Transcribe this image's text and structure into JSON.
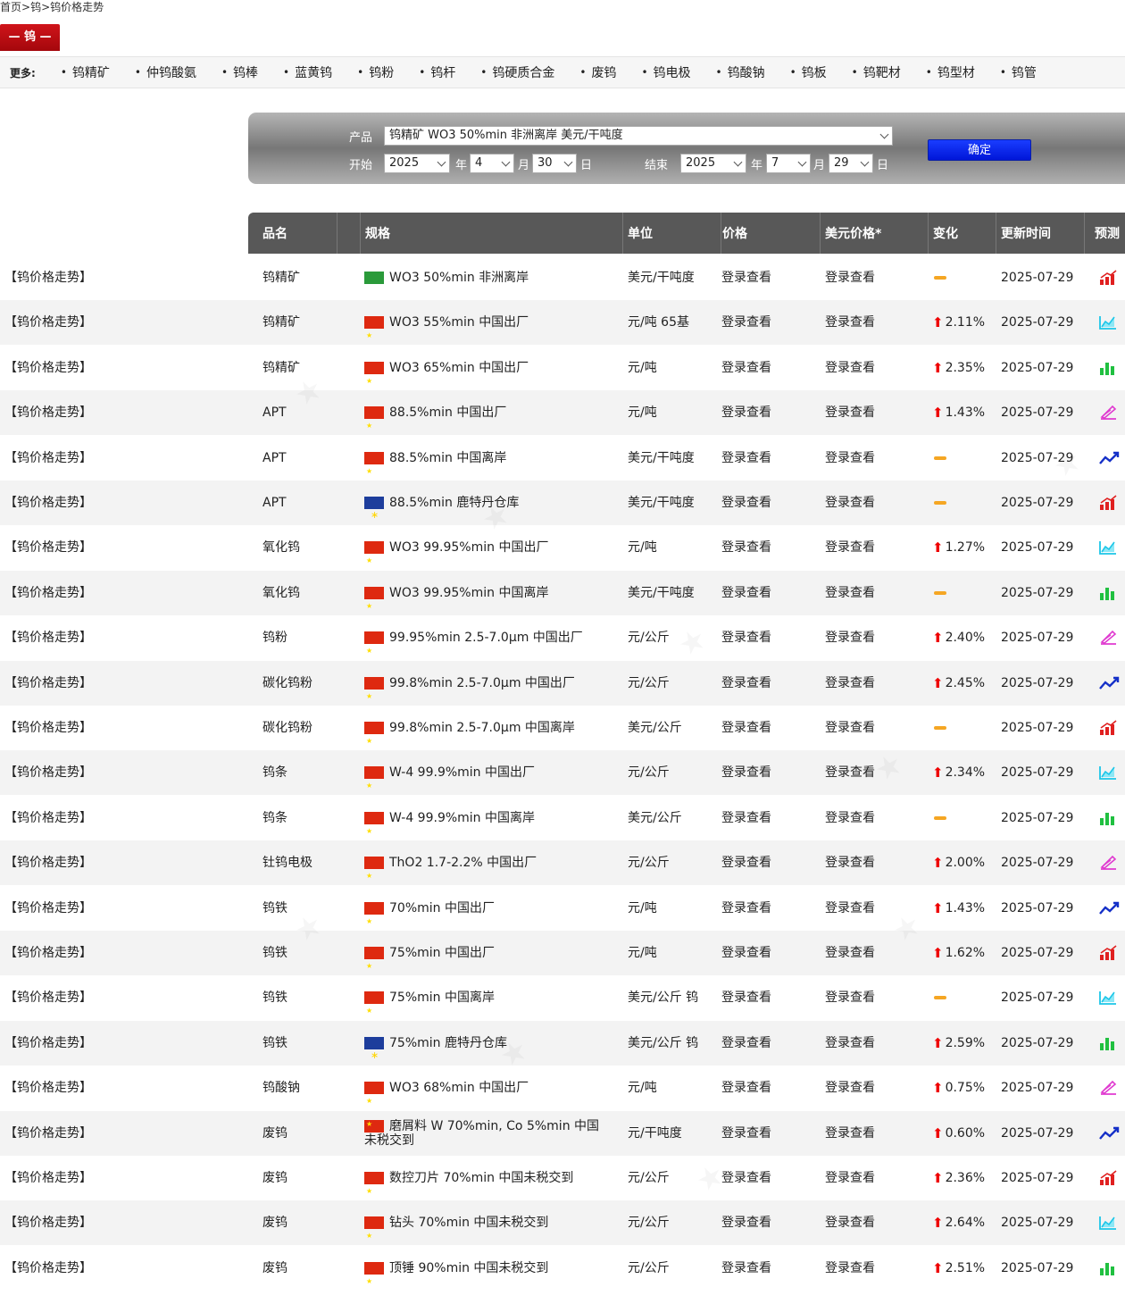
{
  "breadcrumb": {
    "home": "首页",
    "sep1": ">",
    "cat": "钨",
    "sep2": ">",
    "page": "钨价格走势"
  },
  "tag": "— 钨 —",
  "more": {
    "label": "更多:",
    "items": [
      "钨精矿",
      "仲钨酸氨",
      "钨棒",
      "蓝黄钨",
      "钨粉",
      "钨杆",
      "钨硬质合金",
      "废钨",
      "钨电极",
      "钨酸钠",
      "钨板",
      "钨靶材",
      "钨型材",
      "钨管"
    ]
  },
  "filter": {
    "product_label": "产品",
    "product_value": "钨精矿 WO3 50%min 非洲离岸 美元/干吨度",
    "start_label": "开始",
    "end_label": "结束",
    "year_suffix": "年",
    "month_suffix": "月",
    "day_suffix": "日",
    "start": {
      "year": "2025",
      "month": "4",
      "day": "30"
    },
    "end": {
      "year": "2025",
      "month": "7",
      "day": "29"
    },
    "confirm": "确定"
  },
  "table": {
    "headers": {
      "name": "品名",
      "spec": "规格",
      "unit": "单位",
      "price": "价格",
      "usd": "美元价格*",
      "change": "变化",
      "date": "更新时间",
      "forecast": "预测"
    },
    "rows": [
      {
        "trend": "【钨价格走势】",
        "name": "钨精矿",
        "flag": "af",
        "spec": "WO3 50%min 非洲离岸",
        "unit": "美元/干吨度",
        "price": "登录查看",
        "usd": "登录查看",
        "change": "",
        "date": "2025-07-29",
        "fc": "bar-red"
      },
      {
        "trend": "【钨价格走势】",
        "name": "钨精矿",
        "flag": "cn",
        "spec": "WO3 55%min 中国出厂",
        "unit": "元/吨 65基",
        "price": "登录查看",
        "usd": "登录查看",
        "change": "2.11%",
        "date": "2025-07-29",
        "fc": "area-cyan"
      },
      {
        "trend": "【钨价格走势】",
        "name": "钨精矿",
        "flag": "cn",
        "spec": "WO3 65%min 中国出厂",
        "unit": "元/吨",
        "price": "登录查看",
        "usd": "登录查看",
        "change": "2.35%",
        "date": "2025-07-29",
        "fc": "bar-green"
      },
      {
        "trend": "【钨价格走势】",
        "name": "APT",
        "flag": "cn",
        "spec": "88.5%min 中国出厂",
        "unit": "元/吨",
        "price": "登录查看",
        "usd": "登录查看",
        "change": "1.43%",
        "date": "2025-07-29",
        "fc": "pen-pink"
      },
      {
        "trend": "【钨价格走势】",
        "name": "APT",
        "flag": "cn",
        "spec": "88.5%min 中国离岸",
        "unit": "美元/干吨度",
        "price": "登录查看",
        "usd": "登录查看",
        "change": "",
        "date": "2025-07-29",
        "fc": "line-blue"
      },
      {
        "trend": "【钨价格走势】",
        "name": "APT",
        "flag": "eu",
        "spec": "88.5%min 鹿特丹仓库",
        "unit": "美元/干吨度",
        "price": "登录查看",
        "usd": "登录查看",
        "change": "",
        "date": "2025-07-29",
        "fc": "bar-red"
      },
      {
        "trend": "【钨价格走势】",
        "name": "氧化钨",
        "flag": "cn",
        "spec": "WO3 99.95%min 中国出厂",
        "unit": "元/吨",
        "price": "登录查看",
        "usd": "登录查看",
        "change": "1.27%",
        "date": "2025-07-29",
        "fc": "area-cyan"
      },
      {
        "trend": "【钨价格走势】",
        "name": "氧化钨",
        "flag": "cn",
        "spec": "WO3 99.95%min 中国离岸",
        "unit": "美元/干吨度",
        "price": "登录查看",
        "usd": "登录查看",
        "change": "",
        "date": "2025-07-29",
        "fc": "bar-green"
      },
      {
        "trend": "【钨价格走势】",
        "name": "钨粉",
        "flag": "cn",
        "spec": "99.95%min 2.5-7.0μm 中国出厂",
        "unit": "元/公斤",
        "price": "登录查看",
        "usd": "登录查看",
        "change": "2.40%",
        "date": "2025-07-29",
        "fc": "pen-pink"
      },
      {
        "trend": "【钨价格走势】",
        "name": "碳化钨粉",
        "flag": "cn",
        "spec": "99.8%min 2.5-7.0μm 中国出厂",
        "unit": "元/公斤",
        "price": "登录查看",
        "usd": "登录查看",
        "change": "2.45%",
        "date": "2025-07-29",
        "fc": "line-blue"
      },
      {
        "trend": "【钨价格走势】",
        "name": "碳化钨粉",
        "flag": "cn",
        "spec": "99.8%min 2.5-7.0μm 中国离岸",
        "unit": "美元/公斤",
        "price": "登录查看",
        "usd": "登录查看",
        "change": "",
        "date": "2025-07-29",
        "fc": "bar-red"
      },
      {
        "trend": "【钨价格走势】",
        "name": "钨条",
        "flag": "cn",
        "spec": "W-4 99.9%min 中国出厂",
        "unit": "元/公斤",
        "price": "登录查看",
        "usd": "登录查看",
        "change": "2.34%",
        "date": "2025-07-29",
        "fc": "area-cyan"
      },
      {
        "trend": "【钨价格走势】",
        "name": "钨条",
        "flag": "cn",
        "spec": "W-4 99.9%min 中国离岸",
        "unit": "美元/公斤",
        "price": "登录查看",
        "usd": "登录查看",
        "change": "",
        "date": "2025-07-29",
        "fc": "bar-green"
      },
      {
        "trend": "【钨价格走势】",
        "name": "钍钨电极",
        "flag": "cn",
        "spec": "ThO2 1.7-2.2% 中国出厂",
        "unit": "元/公斤",
        "price": "登录查看",
        "usd": "登录查看",
        "change": "2.00%",
        "date": "2025-07-29",
        "fc": "pen-pink"
      },
      {
        "trend": "【钨价格走势】",
        "name": "钨铁",
        "flag": "cn",
        "spec": "70%min 中国出厂",
        "unit": "元/吨",
        "price": "登录查看",
        "usd": "登录查看",
        "change": "1.43%",
        "date": "2025-07-29",
        "fc": "line-blue"
      },
      {
        "trend": "【钨价格走势】",
        "name": "钨铁",
        "flag": "cn",
        "spec": "75%min 中国出厂",
        "unit": "元/吨",
        "price": "登录查看",
        "usd": "登录查看",
        "change": "1.62%",
        "date": "2025-07-29",
        "fc": "bar-red"
      },
      {
        "trend": "【钨价格走势】",
        "name": "钨铁",
        "flag": "cn",
        "spec": "75%min 中国离岸",
        "unit": "美元/公斤 钨",
        "price": "登录查看",
        "usd": "登录查看",
        "change": "",
        "date": "2025-07-29",
        "fc": "area-cyan"
      },
      {
        "trend": "【钨价格走势】",
        "name": "钨铁",
        "flag": "eu",
        "spec": "75%min 鹿特丹仓库",
        "unit": "美元/公斤 钨",
        "price": "登录查看",
        "usd": "登录查看",
        "change": "2.59%",
        "date": "2025-07-29",
        "fc": "bar-green"
      },
      {
        "trend": "【钨价格走势】",
        "name": "钨酸钠",
        "flag": "cn",
        "spec": "WO3 68%min 中国出厂",
        "unit": "元/吨",
        "price": "登录查看",
        "usd": "登录查看",
        "change": "0.75%",
        "date": "2025-07-29",
        "fc": "pen-pink"
      },
      {
        "trend": "【钨价格走势】",
        "name": "废钨",
        "flag": "cn",
        "spec": "磨屑料 W 70%min, Co 5%min 中国未税交到",
        "unit": "元/干吨度",
        "price": "登录查看",
        "usd": "登录查看",
        "change": "0.60%",
        "date": "2025-07-29",
        "fc": "line-blue",
        "wrap": true
      },
      {
        "trend": "【钨价格走势】",
        "name": "废钨",
        "flag": "cn",
        "spec": "数控刀片 70%min 中国未税交到",
        "unit": "元/公斤",
        "price": "登录查看",
        "usd": "登录查看",
        "change": "2.36%",
        "date": "2025-07-29",
        "fc": "bar-red"
      },
      {
        "trend": "【钨价格走势】",
        "name": "废钨",
        "flag": "cn",
        "spec": "钻头 70%min 中国未税交到",
        "unit": "元/公斤",
        "price": "登录查看",
        "usd": "登录查看",
        "change": "2.64%",
        "date": "2025-07-29",
        "fc": "area-cyan"
      },
      {
        "trend": "【钨价格走势】",
        "name": "废钨",
        "flag": "cn",
        "spec": "顶锤 90%min 中国未税交到",
        "unit": "元/公斤",
        "price": "登录查看",
        "usd": "登录查看",
        "change": "2.51%",
        "date": "2025-07-29",
        "fc": "bar-green"
      }
    ]
  },
  "colors": {
    "accent_red": "#c40d12",
    "header_gray": "#585858",
    "confirm_blue": "#0a2ef0",
    "up_red": "#e00000",
    "flat_orange": "#f5a623"
  }
}
